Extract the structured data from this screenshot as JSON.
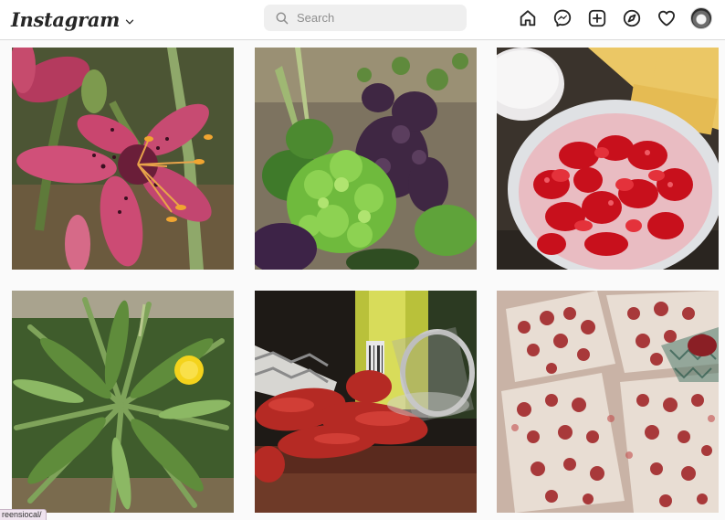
{
  "header": {
    "logo": "Instagram",
    "logo_menu_icon": "chevron-down-icon",
    "search": {
      "placeholder": "Search",
      "value": ""
    },
    "nav_icons": [
      "home-icon",
      "messenger-icon",
      "new-post-icon",
      "explore-icon",
      "activity-heart-icon",
      "profile-avatar"
    ]
  },
  "grid": {
    "posts": [
      {
        "subject": "pink lily flower"
      },
      {
        "subject": "lettuce garden"
      },
      {
        "subject": "sliced strawberries in container"
      },
      {
        "subject": "dandelion plant"
      },
      {
        "subject": "dried strawberry slices and jar"
      },
      {
        "subject": "dried strawberry sheets on parchment"
      }
    ]
  },
  "status_url": "reensiocal/",
  "colors": {
    "header_bg": "#ffffff",
    "page_bg": "#fafafa",
    "border": "#dbdbdb",
    "icon": "#262626",
    "search_bg": "#efefef"
  }
}
